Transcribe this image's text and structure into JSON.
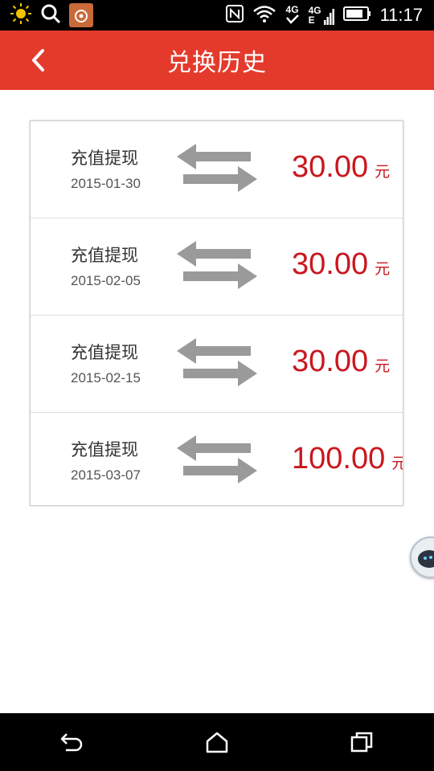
{
  "status_bar": {
    "time": "11:17",
    "network_label": "4G",
    "signal_label_top": "4G",
    "signal_label_bottom": "E",
    "icons": [
      "brightness-icon",
      "search-icon",
      "app-icon",
      "nfc-icon",
      "wifi-icon",
      "data-4g-icon",
      "signal-icon",
      "battery-icon"
    ]
  },
  "header": {
    "title": "兑换历史",
    "background": "#e43a2c"
  },
  "records": [
    {
      "type": "充值提现",
      "date": "2015-01-30",
      "amount": "30.00",
      "unit": "元"
    },
    {
      "type": "充值提现",
      "date": "2015-02-05",
      "amount": "30.00",
      "unit": "元"
    },
    {
      "type": "充值提现",
      "date": "2015-02-15",
      "amount": "30.00",
      "unit": "元"
    },
    {
      "type": "充值提现",
      "date": "2015-03-07",
      "amount": "100.00",
      "unit": "元"
    }
  ],
  "colors": {
    "accent": "#e43a2c",
    "amount": "#c9171e"
  }
}
